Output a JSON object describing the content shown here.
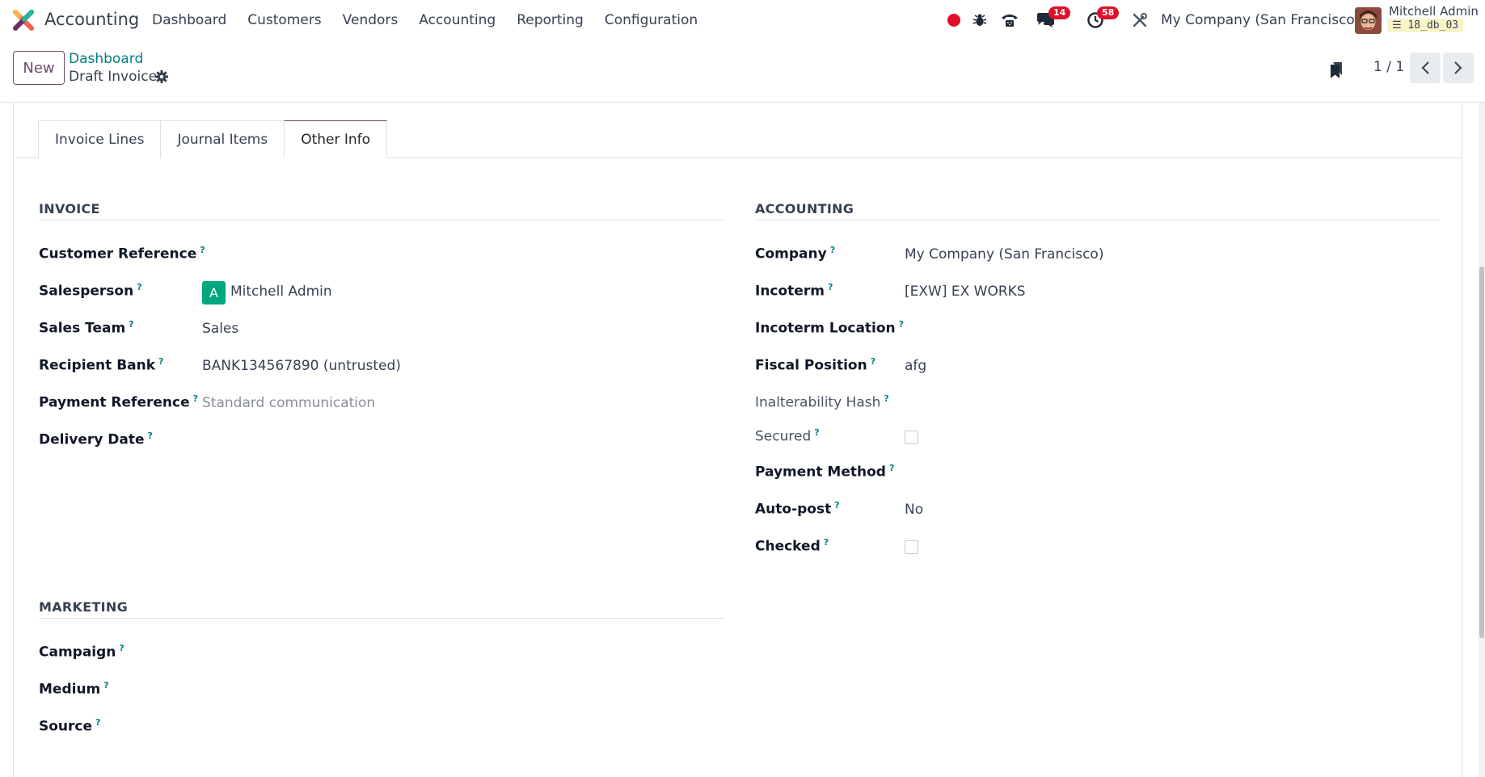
{
  "navbar": {
    "brand": "Accounting",
    "menu": [
      "Dashboard",
      "Customers",
      "Vendors",
      "Accounting",
      "Reporting",
      "Configuration"
    ],
    "chat_badge": "14",
    "activity_badge": "58",
    "company": "My Company (San Francisco)",
    "user_name": "Mitchell Admin",
    "db_name": "18_db_03"
  },
  "control": {
    "new_label": "New",
    "breadcrumb_parent": "Dashboard",
    "breadcrumb_current": "Draft Invoice",
    "pager": "1 / 1"
  },
  "tabs": [
    "Invoice Lines",
    "Journal Items",
    "Other Info"
  ],
  "invoice": {
    "title": "INVOICE",
    "customer_reference_label": "Customer Reference",
    "salesperson_label": "Salesperson",
    "salesperson_initial": "A",
    "salesperson_value": "Mitchell Admin",
    "sales_team_label": "Sales Team",
    "sales_team_value": "Sales",
    "recipient_bank_label": "Recipient Bank",
    "recipient_bank_value": "BANK134567890 (untrusted)",
    "payment_reference_label": "Payment Reference",
    "payment_reference_placeholder": "Standard communication",
    "delivery_date_label": "Delivery Date"
  },
  "marketing": {
    "title": "MARKETING",
    "campaign_label": "Campaign",
    "medium_label": "Medium",
    "source_label": "Source"
  },
  "accounting": {
    "title": "ACCOUNTING",
    "company_label": "Company",
    "company_value": "My Company (San Francisco)",
    "incoterm_label": "Incoterm",
    "incoterm_value": "[EXW] EX WORKS",
    "incoterm_location_label": "Incoterm Location",
    "fiscal_position_label": "Fiscal Position",
    "fiscal_position_value": "afg",
    "hash_label": "Inalterability Hash",
    "secured_label": "Secured",
    "payment_method_label": "Payment Method",
    "autopost_label": "Auto-post",
    "autopost_value": "No",
    "checked_label": "Checked"
  },
  "help_mark": "?"
}
